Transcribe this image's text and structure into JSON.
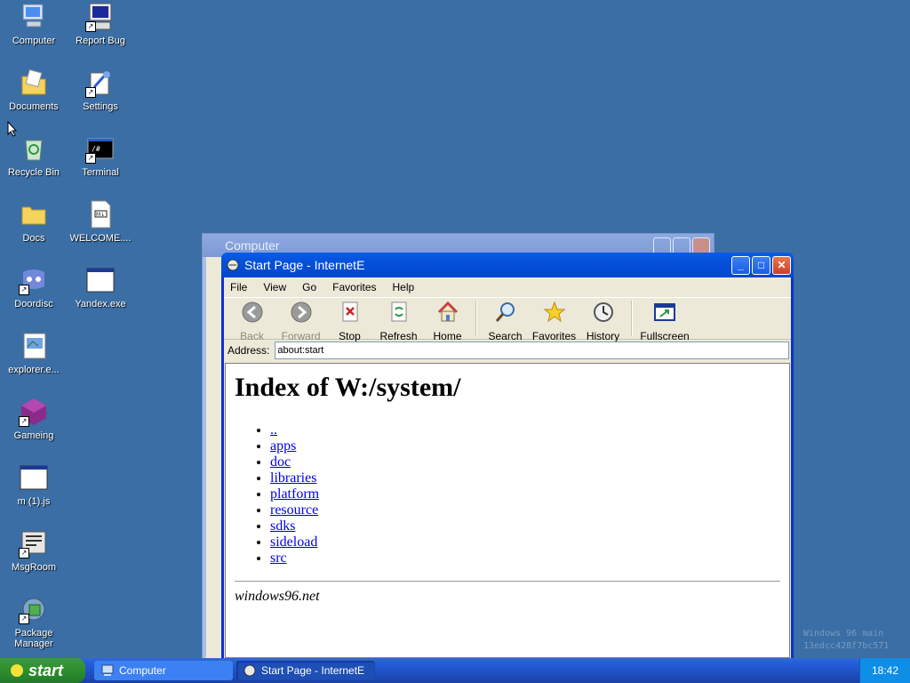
{
  "desktop": {
    "icons": [
      {
        "label": "Computer",
        "icon": "computer-icon"
      },
      {
        "label": "Report Bug",
        "icon": "report-bug-icon"
      },
      {
        "label": "Documents",
        "icon": "documents-icon"
      },
      {
        "label": "Settings",
        "icon": "settings-icon"
      },
      {
        "label": "Recycle Bin",
        "icon": "recycle-bin-icon"
      },
      {
        "label": "Terminal",
        "icon": "terminal-icon"
      },
      {
        "label": "Docs",
        "icon": "folder-icon"
      },
      {
        "label": "WELCOME....",
        "icon": "markdown-file-icon"
      },
      {
        "label": "Doordisc",
        "icon": "doordisc-icon"
      },
      {
        "label": "Yandex.exe",
        "icon": "app-window-icon"
      },
      {
        "label": "explorer.e...",
        "icon": "explorer-icon"
      },
      {
        "label": "Gameing",
        "icon": "gameing-icon"
      },
      {
        "label": "m (1).js",
        "icon": "js-file-icon"
      },
      {
        "label": "MsgRoom",
        "icon": "msgroom-icon"
      },
      {
        "label": "Package Manager",
        "icon": "package-manager-icon"
      }
    ],
    "watermark": [
      "Windows 96 main",
      "13edcc428f7bc571"
    ]
  },
  "background_window": {
    "title": "Computer"
  },
  "browser": {
    "title": "Start Page - InternetE",
    "menu": [
      "File",
      "View",
      "Go",
      "Favorites",
      "Help"
    ],
    "toolbar": [
      {
        "label": "Back",
        "icon": "back-arrow-icon",
        "enabled": false
      },
      {
        "label": "Forward",
        "icon": "forward-arrow-icon",
        "enabled": false
      },
      {
        "label": "Stop",
        "icon": "stop-icon",
        "enabled": true
      },
      {
        "label": "Refresh",
        "icon": "refresh-icon",
        "enabled": true
      },
      {
        "label": "Home",
        "icon": "home-icon",
        "enabled": true
      },
      {
        "label": "Search",
        "icon": "search-icon",
        "enabled": true
      },
      {
        "label": "Favorites",
        "icon": "star-icon",
        "enabled": true
      },
      {
        "label": "History",
        "icon": "history-icon",
        "enabled": true
      },
      {
        "label": "Fullscreen",
        "icon": "fullscreen-icon",
        "enabled": true
      }
    ],
    "address_label": "Address:",
    "address_value": "about:start",
    "page": {
      "heading": "Index of W:/system/",
      "links": [
        "..",
        "apps",
        "doc",
        "libraries",
        "platform",
        "resource",
        "sdks",
        "sideload",
        "src"
      ],
      "footer": "windows96.net"
    }
  },
  "taskbar": {
    "start_label": "start",
    "tasks": [
      {
        "label": "Computer",
        "active": false
      },
      {
        "label": "Start Page - InternetE",
        "active": true
      }
    ],
    "clock": "18:42"
  },
  "colors": {
    "desktop": "#3a6ea5",
    "titlebar": "#0550d9",
    "start_button": "#2e8f2e",
    "link": "#0000ee"
  }
}
